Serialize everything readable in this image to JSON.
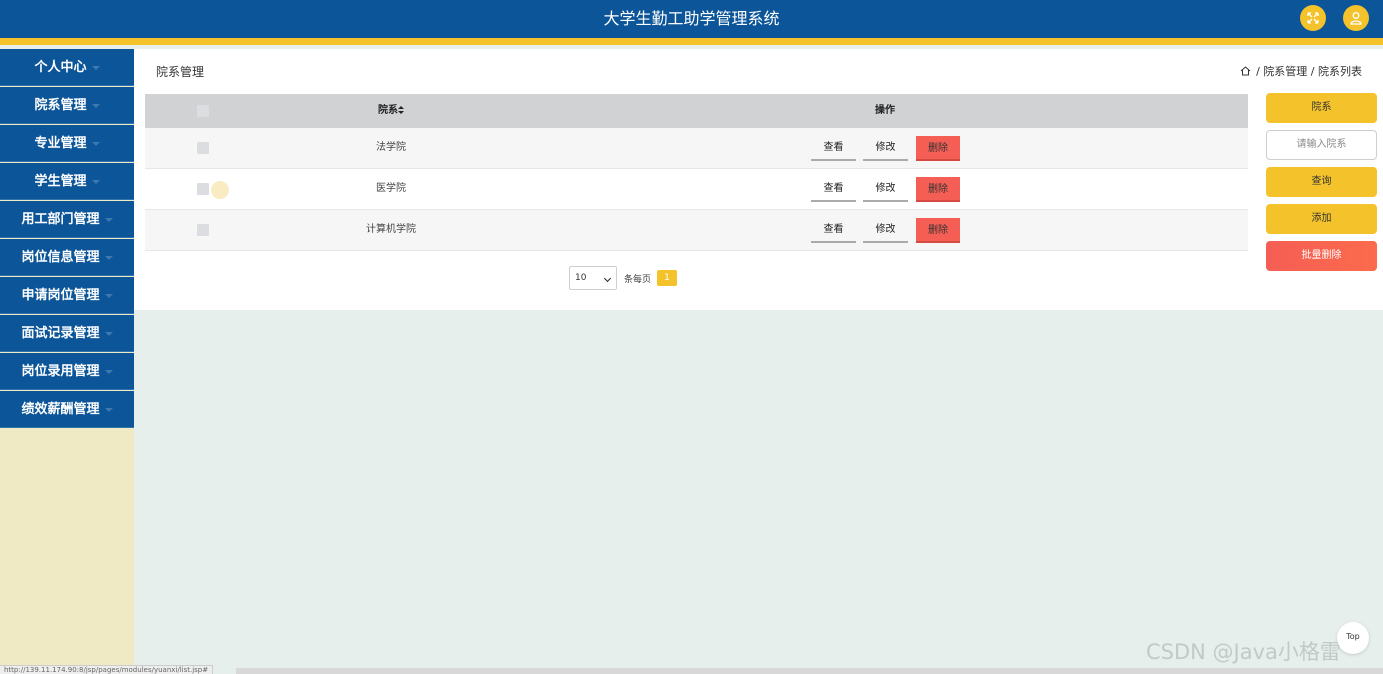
{
  "header": {
    "title": "大学生勤工助学管理系统",
    "fullscreen_icon": "expand-icon",
    "user_icon": "user-icon",
    "colors": {
      "primary": "#0b5598",
      "accent": "#f4c22b",
      "danger": "#f55e55"
    }
  },
  "sidebar": {
    "items": [
      {
        "label": "个人中心"
      },
      {
        "label": "院系管理"
      },
      {
        "label": "专业管理"
      },
      {
        "label": "学生管理"
      },
      {
        "label": "用工部门管理"
      },
      {
        "label": "岗位信息管理"
      },
      {
        "label": "申请岗位管理"
      },
      {
        "label": "面试记录管理"
      },
      {
        "label": "岗位录用管理"
      },
      {
        "label": "绩效薪酬管理"
      }
    ]
  },
  "main": {
    "title": "院系管理",
    "breadcrumb": {
      "separator": "/",
      "items": [
        "院系管理",
        "院系列表"
      ]
    }
  },
  "table": {
    "columns": {
      "department": "院系",
      "sort_icon": "sort-icon",
      "actions": "操作"
    },
    "rows": [
      {
        "department": "法学院"
      },
      {
        "department": "医学院"
      },
      {
        "department": "计算机学院"
      }
    ],
    "actions": {
      "view": "查看",
      "edit": "修改",
      "delete": "删除"
    }
  },
  "pagination": {
    "page_size": "10",
    "per_page_label": "条每页",
    "current_page": "1"
  },
  "side_panel": {
    "search_label": "院系",
    "search_placeholder": "请输入院系",
    "query_label": "查询",
    "add_label": "添加",
    "batch_delete_label": "批量删除"
  },
  "misc": {
    "top_button": "Top",
    "watermark": "CSDN @Java小格雷",
    "status_url": "http://139.11.174.90:8/jsp/pages/modules/yuanxi/list.jsp#"
  }
}
